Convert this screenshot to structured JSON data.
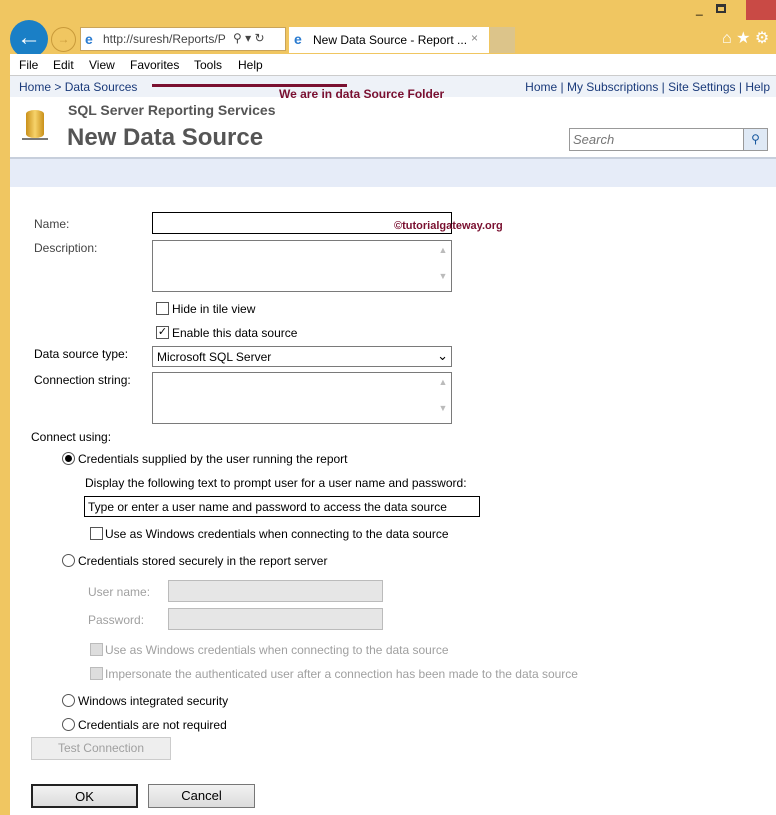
{
  "browser": {
    "url": "http://suresh/Reports/P",
    "tab_title": "New Data Source - Report ...",
    "menu": [
      "File",
      "Edit",
      "View",
      "Favorites",
      "Tools",
      "Help"
    ]
  },
  "breadcrumb": {
    "home": "Home",
    "sep": ">",
    "current": "Data Sources"
  },
  "annotation": "We are in data Source Folder",
  "watermark": "©tutorialgateway.org",
  "top_links": [
    "Home",
    "My Subscriptions",
    "Site Settings",
    "Help"
  ],
  "header": {
    "subtitle": "SQL Server Reporting Services",
    "title": "New Data Source",
    "search_placeholder": "Search"
  },
  "form": {
    "name_label": "Name:",
    "name_value": "",
    "description_label": "Description:",
    "hide_tile": "Hide in tile view",
    "hide_tile_checked": false,
    "enable": "Enable this data source",
    "enable_checked": true,
    "type_label": "Data source type:",
    "type_value": "Microsoft SQL Server",
    "conn_label": "Connection string:",
    "connect_using": "Connect using:",
    "opt1": "Credentials supplied by the user running the report",
    "prompt_label": "Display the following text to prompt user for a user name and password:",
    "prompt_value": "Type or enter a user name and password to access the data source",
    "use_windows1": "Use as Windows credentials when connecting to the data source",
    "opt2": "Credentials stored securely in the report server",
    "user_label": "User name:",
    "pass_label": "Password:",
    "use_windows2": "Use as Windows credentials when connecting to the data source",
    "impersonate": "Impersonate the authenticated user after a connection has been made to the data source",
    "opt3": "Windows integrated security",
    "opt4": "Credentials are not required",
    "selected_option": "opt1",
    "test": "Test Connection",
    "ok": "OK",
    "cancel": "Cancel"
  }
}
